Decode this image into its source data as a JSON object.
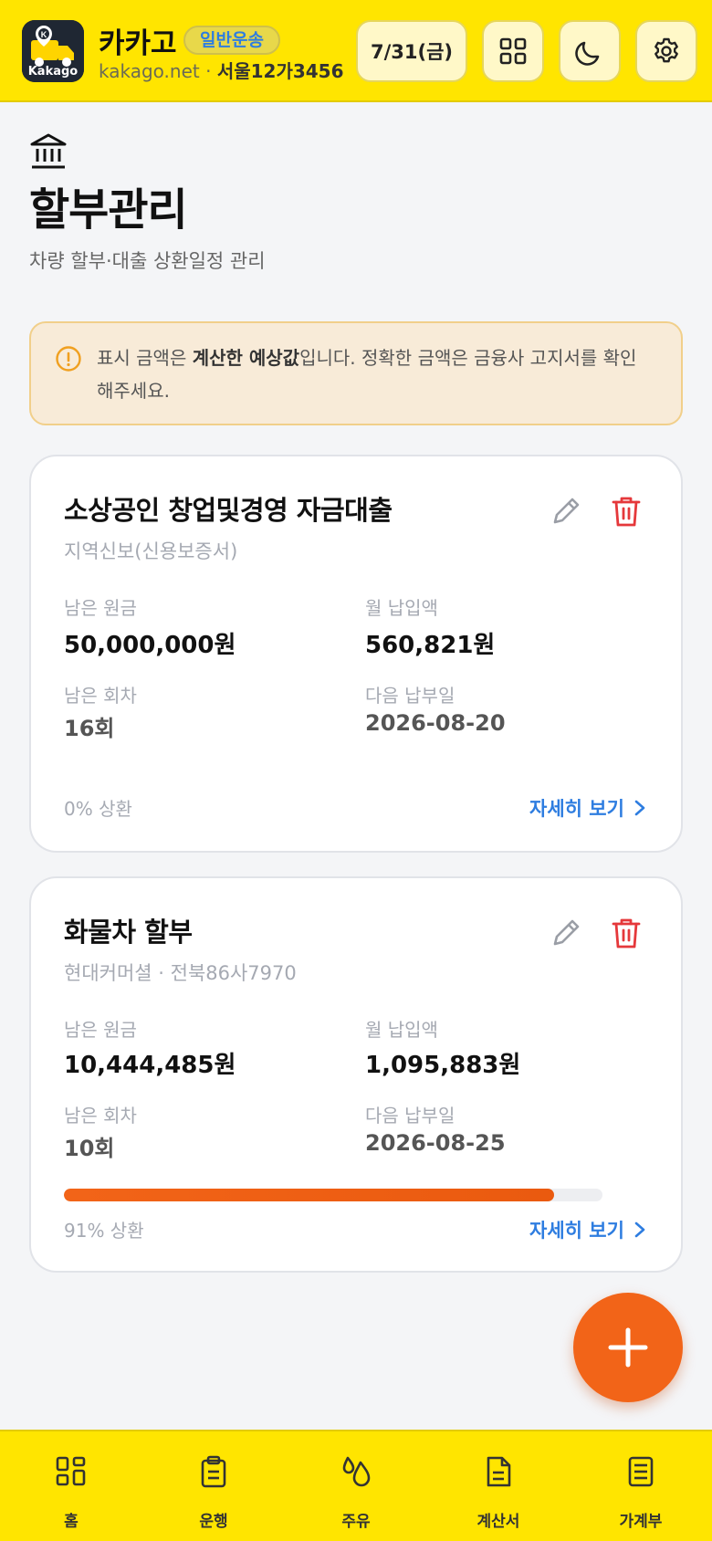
{
  "header": {
    "app_name": "카카고",
    "badge": "일반운송",
    "site": "kakago.net",
    "separator": " · ",
    "plate": "서울12가3456",
    "date": "7/31(금)",
    "logo_label": "Kakago",
    "logo_letter": "K"
  },
  "page": {
    "title": "할부관리",
    "subtitle": "차량 할부·대출 상환일정 관리"
  },
  "notice": {
    "text_before": "표시 금액은 ",
    "text_bold": "계산한 예상값",
    "text_after": "입니다. 정확한 금액은 금융사 고지서를 확인해주세요."
  },
  "loans": [
    {
      "title": "소상공인 창업및경영 자금대출",
      "sub": "지역신보(신용보증서)",
      "remaining_principal_label": "남은 원금",
      "remaining_principal": "50,000,000원",
      "monthly_label": "월 납입액",
      "monthly": "560,821원",
      "remaining_count_label": "남은 회차",
      "remaining_count": "16회",
      "next_date_label": "다음 납부일",
      "next_date": "2026-08-20",
      "repaid_pct": 0,
      "repaid_text": "0% 상환",
      "detail_label": "자세히 보기"
    },
    {
      "title": "화물차 할부",
      "sub": "현대커머셜 · 전북86사7970",
      "remaining_principal_label": "남은 원금",
      "remaining_principal": "10,444,485원",
      "monthly_label": "월 납입액",
      "monthly": "1,095,883원",
      "remaining_count_label": "남은 회차",
      "remaining_count": "10회",
      "next_date_label": "다음 납부일",
      "next_date": "2026-08-25",
      "repaid_pct": 91,
      "repaid_text": "91% 상환",
      "detail_label": "자세히 보기"
    }
  ],
  "bottom_nav": [
    {
      "label": "홈",
      "icon": "grid-icon"
    },
    {
      "label": "운행",
      "icon": "clipboard-icon"
    },
    {
      "label": "주유",
      "icon": "fuel-drop-icon"
    },
    {
      "label": "계산서",
      "icon": "document-icon"
    },
    {
      "label": "가계부",
      "icon": "ledger-icon"
    }
  ],
  "colors": {
    "brand_yellow": "#ffe500",
    "accent_orange": "#f26418",
    "link_blue": "#2e7de0",
    "delete_red": "#e5383b"
  }
}
